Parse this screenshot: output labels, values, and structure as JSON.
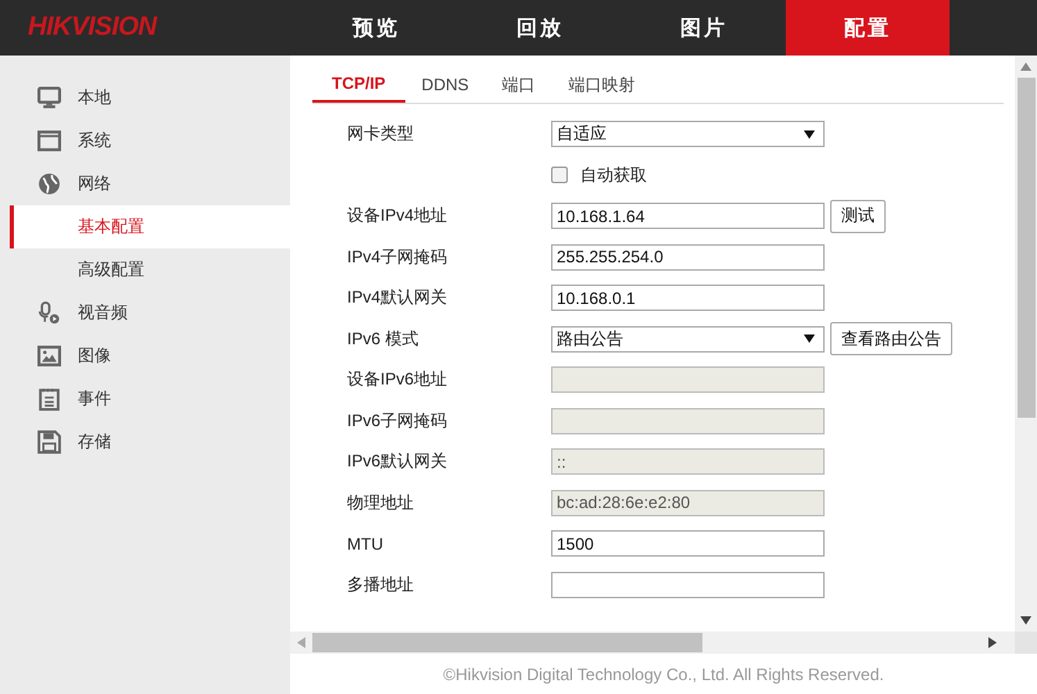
{
  "header": {
    "logo": "HIKVISION",
    "nav": [
      {
        "label": "预览",
        "selected": false
      },
      {
        "label": "回放",
        "selected": false
      },
      {
        "label": "图片",
        "selected": false
      },
      {
        "label": "配置",
        "selected": true
      }
    ]
  },
  "sidebar": {
    "items": [
      {
        "label": "本地",
        "selected": false
      },
      {
        "label": "系统",
        "selected": false
      },
      {
        "label": "网络",
        "selected": false,
        "children": [
          {
            "label": "基本配置",
            "selected": true
          },
          {
            "label": "高级配置",
            "selected": false
          }
        ]
      },
      {
        "label": "视音频",
        "selected": false
      },
      {
        "label": "图像",
        "selected": false
      },
      {
        "label": "事件",
        "selected": false
      },
      {
        "label": "存储",
        "selected": false
      }
    ]
  },
  "tabs": [
    {
      "label": "TCP/IP",
      "selected": true
    },
    {
      "label": "DDNS",
      "selected": false
    },
    {
      "label": "端口",
      "selected": false
    },
    {
      "label": "端口映射",
      "selected": false
    }
  ],
  "form": [
    {
      "kind": "select",
      "label": "网卡类型",
      "value": "自适应"
    },
    {
      "kind": "checkbox",
      "label": "自动获取",
      "checked": false
    },
    {
      "kind": "input",
      "label": "设备IPv4地址",
      "value": "10.168.1.64",
      "disabled": false,
      "button": "测试"
    },
    {
      "kind": "input",
      "label": "IPv4子网掩码",
      "value": "255.255.254.0",
      "disabled": false
    },
    {
      "kind": "input",
      "label": "IPv4默认网关",
      "value": "10.168.0.1",
      "disabled": false
    },
    {
      "kind": "select",
      "label": "IPv6 模式",
      "value": "路由公告",
      "button": "查看路由公告"
    },
    {
      "kind": "input",
      "label": "设备IPv6地址",
      "disabled": true
    },
    {
      "kind": "input",
      "label": "IPv6子网掩码",
      "disabled": true
    },
    {
      "kind": "input",
      "label": "IPv6默认网关",
      "value": "::",
      "disabled": true
    },
    {
      "kind": "input",
      "label": "物理地址",
      "value": "bc:ad:28:6e:e2:80",
      "disabled": true
    },
    {
      "kind": "input",
      "label": "MTU",
      "value": "1500",
      "disabled": false
    },
    {
      "kind": "input",
      "label": "多播地址",
      "disabled": false
    }
  ],
  "footer": "©Hikvision Digital Technology Co., Ltd. All Rights Reserved."
}
